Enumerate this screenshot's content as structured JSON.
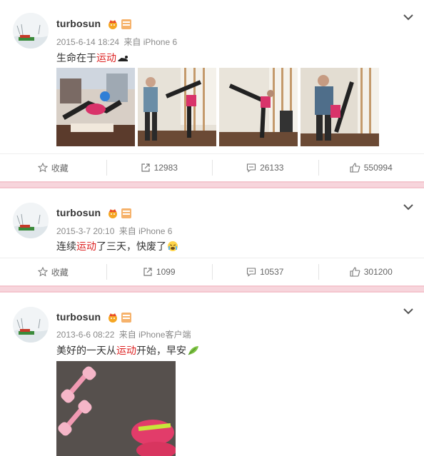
{
  "posts": [
    {
      "username": "turbosun",
      "date": "2015-6-14 18:24",
      "source": "来自 iPhone 6",
      "text_before": "生命在于",
      "keyword": "运动",
      "text_after": "",
      "emoji": "pushup-emoji",
      "actions": {
        "collect": "收藏",
        "repost": "12983",
        "comment": "26133",
        "like": "550994"
      }
    },
    {
      "username": "turbosun",
      "date": "2015-3-7 20:10",
      "source": "来自 iPhone 6",
      "text_before": "连续",
      "keyword": "运动",
      "text_after": "了三天，快废了",
      "emoji": "crying-face-emoji",
      "actions": {
        "collect": "收藏",
        "repost": "1099",
        "comment": "10537",
        "like": "301200"
      }
    },
    {
      "username": "turbosun",
      "date": "2013-6-6 08:22",
      "source": "来自 iPhone客户端",
      "text_before": "美好的一天从",
      "keyword": "运动",
      "text_after": "开始，早安",
      "emoji": "leaf-emoji"
    }
  ],
  "colors": {
    "keyword": "#dd2222",
    "separator": "#f4c6cf",
    "meta": "#8a8a8a"
  }
}
